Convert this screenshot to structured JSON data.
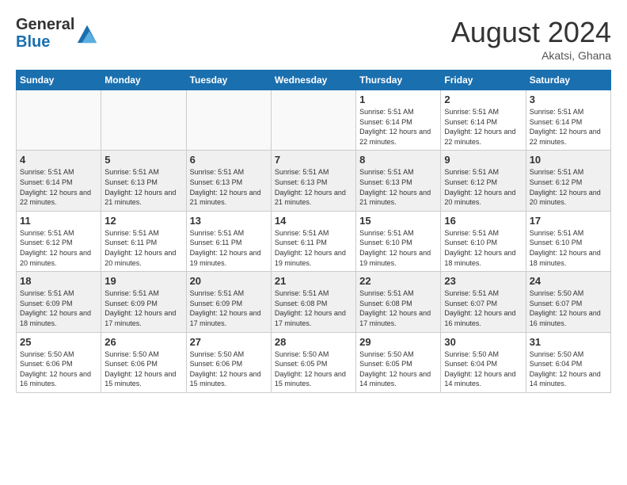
{
  "header": {
    "logo_line1": "General",
    "logo_line2": "Blue",
    "month_year": "August 2024",
    "location": "Akatsi, Ghana"
  },
  "weekdays": [
    "Sunday",
    "Monday",
    "Tuesday",
    "Wednesday",
    "Thursday",
    "Friday",
    "Saturday"
  ],
  "weeks": [
    [
      {
        "day": "",
        "sunrise": "",
        "sunset": "",
        "daylight": ""
      },
      {
        "day": "",
        "sunrise": "",
        "sunset": "",
        "daylight": ""
      },
      {
        "day": "",
        "sunrise": "",
        "sunset": "",
        "daylight": ""
      },
      {
        "day": "",
        "sunrise": "",
        "sunset": "",
        "daylight": ""
      },
      {
        "day": "1",
        "sunrise": "Sunrise: 5:51 AM",
        "sunset": "Sunset: 6:14 PM",
        "daylight": "Daylight: 12 hours and 22 minutes."
      },
      {
        "day": "2",
        "sunrise": "Sunrise: 5:51 AM",
        "sunset": "Sunset: 6:14 PM",
        "daylight": "Daylight: 12 hours and 22 minutes."
      },
      {
        "day": "3",
        "sunrise": "Sunrise: 5:51 AM",
        "sunset": "Sunset: 6:14 PM",
        "daylight": "Daylight: 12 hours and 22 minutes."
      }
    ],
    [
      {
        "day": "4",
        "sunrise": "Sunrise: 5:51 AM",
        "sunset": "Sunset: 6:14 PM",
        "daylight": "Daylight: 12 hours and 22 minutes."
      },
      {
        "day": "5",
        "sunrise": "Sunrise: 5:51 AM",
        "sunset": "Sunset: 6:13 PM",
        "daylight": "Daylight: 12 hours and 21 minutes."
      },
      {
        "day": "6",
        "sunrise": "Sunrise: 5:51 AM",
        "sunset": "Sunset: 6:13 PM",
        "daylight": "Daylight: 12 hours and 21 minutes."
      },
      {
        "day": "7",
        "sunrise": "Sunrise: 5:51 AM",
        "sunset": "Sunset: 6:13 PM",
        "daylight": "Daylight: 12 hours and 21 minutes."
      },
      {
        "day": "8",
        "sunrise": "Sunrise: 5:51 AM",
        "sunset": "Sunset: 6:13 PM",
        "daylight": "Daylight: 12 hours and 21 minutes."
      },
      {
        "day": "9",
        "sunrise": "Sunrise: 5:51 AM",
        "sunset": "Sunset: 6:12 PM",
        "daylight": "Daylight: 12 hours and 20 minutes."
      },
      {
        "day": "10",
        "sunrise": "Sunrise: 5:51 AM",
        "sunset": "Sunset: 6:12 PM",
        "daylight": "Daylight: 12 hours and 20 minutes."
      }
    ],
    [
      {
        "day": "11",
        "sunrise": "Sunrise: 5:51 AM",
        "sunset": "Sunset: 6:12 PM",
        "daylight": "Daylight: 12 hours and 20 minutes."
      },
      {
        "day": "12",
        "sunrise": "Sunrise: 5:51 AM",
        "sunset": "Sunset: 6:11 PM",
        "daylight": "Daylight: 12 hours and 20 minutes."
      },
      {
        "day": "13",
        "sunrise": "Sunrise: 5:51 AM",
        "sunset": "Sunset: 6:11 PM",
        "daylight": "Daylight: 12 hours and 19 minutes."
      },
      {
        "day": "14",
        "sunrise": "Sunrise: 5:51 AM",
        "sunset": "Sunset: 6:11 PM",
        "daylight": "Daylight: 12 hours and 19 minutes."
      },
      {
        "day": "15",
        "sunrise": "Sunrise: 5:51 AM",
        "sunset": "Sunset: 6:10 PM",
        "daylight": "Daylight: 12 hours and 19 minutes."
      },
      {
        "day": "16",
        "sunrise": "Sunrise: 5:51 AM",
        "sunset": "Sunset: 6:10 PM",
        "daylight": "Daylight: 12 hours and 18 minutes."
      },
      {
        "day": "17",
        "sunrise": "Sunrise: 5:51 AM",
        "sunset": "Sunset: 6:10 PM",
        "daylight": "Daylight: 12 hours and 18 minutes."
      }
    ],
    [
      {
        "day": "18",
        "sunrise": "Sunrise: 5:51 AM",
        "sunset": "Sunset: 6:09 PM",
        "daylight": "Daylight: 12 hours and 18 minutes."
      },
      {
        "day": "19",
        "sunrise": "Sunrise: 5:51 AM",
        "sunset": "Sunset: 6:09 PM",
        "daylight": "Daylight: 12 hours and 17 minutes."
      },
      {
        "day": "20",
        "sunrise": "Sunrise: 5:51 AM",
        "sunset": "Sunset: 6:09 PM",
        "daylight": "Daylight: 12 hours and 17 minutes."
      },
      {
        "day": "21",
        "sunrise": "Sunrise: 5:51 AM",
        "sunset": "Sunset: 6:08 PM",
        "daylight": "Daylight: 12 hours and 17 minutes."
      },
      {
        "day": "22",
        "sunrise": "Sunrise: 5:51 AM",
        "sunset": "Sunset: 6:08 PM",
        "daylight": "Daylight: 12 hours and 17 minutes."
      },
      {
        "day": "23",
        "sunrise": "Sunrise: 5:51 AM",
        "sunset": "Sunset: 6:07 PM",
        "daylight": "Daylight: 12 hours and 16 minutes."
      },
      {
        "day": "24",
        "sunrise": "Sunrise: 5:50 AM",
        "sunset": "Sunset: 6:07 PM",
        "daylight": "Daylight: 12 hours and 16 minutes."
      }
    ],
    [
      {
        "day": "25",
        "sunrise": "Sunrise: 5:50 AM",
        "sunset": "Sunset: 6:06 PM",
        "daylight": "Daylight: 12 hours and 16 minutes."
      },
      {
        "day": "26",
        "sunrise": "Sunrise: 5:50 AM",
        "sunset": "Sunset: 6:06 PM",
        "daylight": "Daylight: 12 hours and 15 minutes."
      },
      {
        "day": "27",
        "sunrise": "Sunrise: 5:50 AM",
        "sunset": "Sunset: 6:06 PM",
        "daylight": "Daylight: 12 hours and 15 minutes."
      },
      {
        "day": "28",
        "sunrise": "Sunrise: 5:50 AM",
        "sunset": "Sunset: 6:05 PM",
        "daylight": "Daylight: 12 hours and 15 minutes."
      },
      {
        "day": "29",
        "sunrise": "Sunrise: 5:50 AM",
        "sunset": "Sunset: 6:05 PM",
        "daylight": "Daylight: 12 hours and 14 minutes."
      },
      {
        "day": "30",
        "sunrise": "Sunrise: 5:50 AM",
        "sunset": "Sunset: 6:04 PM",
        "daylight": "Daylight: 12 hours and 14 minutes."
      },
      {
        "day": "31",
        "sunrise": "Sunrise: 5:50 AM",
        "sunset": "Sunset: 6:04 PM",
        "daylight": "Daylight: 12 hours and 14 minutes."
      }
    ]
  ]
}
